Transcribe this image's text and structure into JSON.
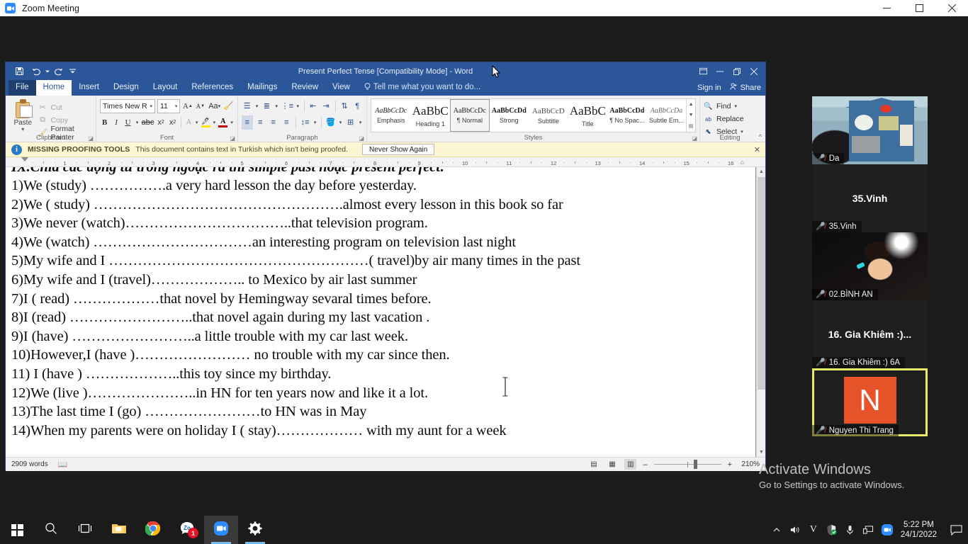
{
  "zoom_window": {
    "title": "Zoom Meeting",
    "logo_icon": "zoom-camera-icon",
    "controls": {
      "minimize": "–",
      "maximize": "▢",
      "close": "✕"
    }
  },
  "word": {
    "titlebar": {
      "title": "Present Perfect Tense [Compatibility Mode] - Word",
      "qat": [
        {
          "name": "save-icon",
          "glyph": "🖫"
        },
        {
          "name": "undo-icon",
          "glyph": "↶"
        },
        {
          "name": "undo-dropdown-icon",
          "glyph": "▾"
        },
        {
          "name": "redo-icon",
          "glyph": "↷"
        },
        {
          "name": "customize-qat-icon",
          "glyph": "▾"
        }
      ],
      "window_buttons": {
        "ribbon_display": "⊡",
        "minimize": "–",
        "restore": "❐",
        "close": "✕"
      }
    },
    "tabs": [
      {
        "label": "File",
        "active": false
      },
      {
        "label": "Home",
        "active": true
      },
      {
        "label": "Insert",
        "active": false
      },
      {
        "label": "Design",
        "active": false
      },
      {
        "label": "Layout",
        "active": false
      },
      {
        "label": "References",
        "active": false
      },
      {
        "label": "Mailings",
        "active": false
      },
      {
        "label": "Review",
        "active": false
      },
      {
        "label": "View",
        "active": false
      }
    ],
    "tell_me": "Tell me what you want to do...",
    "sign_in": "Sign in",
    "share": "Share",
    "ribbon": {
      "clipboard": {
        "group_label": "Clipboard",
        "paste_label": "Paste",
        "cut_label": "Cut",
        "copy_label": "Copy",
        "format_painter_label": "Format Painter"
      },
      "font": {
        "group_label": "Font",
        "font_name": "Times New Ro",
        "font_size": "11",
        "buttons": [
          "grow-font",
          "shrink-font",
          "change-case",
          "clear-formatting",
          "bold",
          "italic",
          "underline",
          "strikethrough",
          "subscript",
          "superscript",
          "text-effects",
          "text-highlight",
          "font-color"
        ]
      },
      "paragraph": {
        "group_label": "Paragraph"
      },
      "styles": {
        "group_label": "Styles",
        "gallery": [
          {
            "preview": "AaBbCcDc",
            "name": "Emphasis",
            "selected": false
          },
          {
            "preview": "AaBbC",
            "name": "Heading 1",
            "selected": false
          },
          {
            "preview": "AaBbCcDc",
            "name": "¶ Normal",
            "selected": true
          },
          {
            "preview": "AaBbCcDd",
            "name": "Strong",
            "selected": false
          },
          {
            "preview": "AaBbCcD",
            "name": "Subtitle",
            "selected": false
          },
          {
            "preview": "AaBbC",
            "name": "Title",
            "selected": false
          },
          {
            "preview": "AaBbCcDd",
            "name": "¶ No Spac...",
            "selected": false
          },
          {
            "preview": "AaBbCcDa",
            "name": "Subtle Em...",
            "selected": false
          }
        ]
      },
      "editing": {
        "group_label": "Editing",
        "find": "Find",
        "replace": "Replace",
        "select": "Select"
      }
    },
    "proofing_bar": {
      "title": "MISSING PROOFING TOOLS",
      "message": "This document contains text in Turkish which isn't being proofed.",
      "button": "Never Show Again",
      "close": "✕"
    },
    "ruler": {
      "marks": [
        "1",
        "2",
        "3",
        "4",
        "5",
        "6",
        "7",
        "8",
        "9",
        "10",
        "11",
        "12",
        "13",
        "14",
        "15",
        "16"
      ]
    },
    "document": {
      "heading": "IX.Chia các động từ trong ngoặc ra thì simple past hoặc present perfect:",
      "lines": [
        "1)We (study) …………….a very hard lesson the day before yesterday.",
        "2)We ( study) …………………………………………….almost every lesson in this book so far",
        "3)We  never (watch)……………………………..that television program.",
        "4)We (watch) ……………………………an interesting program on television last night",
        "5)My wife and I ………………………………………………( travel)by air many times in the past",
        "6)My wife and I (travel)……………….. to Mexico by air last summer",
        "7)I ( read) ………………that novel by Hemingway sevaral times before.",
        "8)I (read) ……………………..that novel again during my last vacation .",
        "9)I (have) ……………………..a little trouble with my car last week.",
        "10)However,I (have )…………………… no trouble with my car since then.",
        "11) I (have ) ………………..this toy since my birthday.",
        "12)We (live )…………………..in HN for ten years now and like it a lot.",
        "13)The last time I (go) ……………………to HN was in May",
        "14)When my parents were on holiday I ( stay)……………… with my aunt for a week"
      ]
    },
    "status_bar": {
      "word_count": "2909 words",
      "proofing_icon": "proofing-errors-icon",
      "views": [
        "read-mode",
        "print-layout",
        "web-layout"
      ],
      "zoom_out": "–",
      "zoom_in": "+",
      "zoom_level": "210%"
    }
  },
  "participants": [
    {
      "name": "Da",
      "muted": true,
      "type": "video",
      "active": false
    },
    {
      "name": "35.Vinh",
      "display_name": "35.Vinh",
      "muted": true,
      "type": "name",
      "active": false
    },
    {
      "name": "02.BÌNH AN",
      "muted": true,
      "type": "video",
      "active": false
    },
    {
      "name": "16. Gia Khiêm :) 6A",
      "display_name": "16. Gia Khiêm :)...",
      "muted": true,
      "type": "name",
      "active": false
    },
    {
      "name": "Nguyen Thi Trang",
      "avatar_letter": "N",
      "avatar_color": "#e8542a",
      "muted": true,
      "type": "avatar",
      "active": true
    }
  ],
  "watermark": {
    "title": "Activate Windows",
    "subtitle": "Go to Settings to activate Windows."
  },
  "taskbar": {
    "items": [
      {
        "name": "start-button",
        "icon": "windows-logo-icon"
      },
      {
        "name": "search-button",
        "icon": "search-icon"
      },
      {
        "name": "task-view-button",
        "icon": "task-view-icon"
      },
      {
        "name": "file-explorer-button",
        "icon": "folder-icon"
      },
      {
        "name": "chrome-button",
        "icon": "chrome-icon"
      },
      {
        "name": "zalo-button",
        "icon": "zalo-icon",
        "badge": "1"
      },
      {
        "name": "zoom-button",
        "icon": "zoom-camera-icon",
        "active": true
      },
      {
        "name": "settings-button",
        "icon": "gear-icon"
      }
    ],
    "tray": [
      {
        "name": "show-hidden-icons",
        "icon": "chevron-up-icon"
      },
      {
        "name": "volume-icon",
        "icon": "speaker-icon"
      },
      {
        "name": "unikey-icon",
        "icon": "V"
      },
      {
        "name": "windows-security-icon",
        "icon": "shield-check-icon"
      },
      {
        "name": "microphone-icon",
        "icon": "mic-icon"
      },
      {
        "name": "network-icon",
        "icon": "monitor-icon"
      },
      {
        "name": "zoom-tray-icon",
        "icon": "zoom-camera-icon"
      }
    ],
    "clock": {
      "time": "5:22 PM",
      "date": "24/1/2022"
    },
    "action_center": "notification-icon"
  }
}
